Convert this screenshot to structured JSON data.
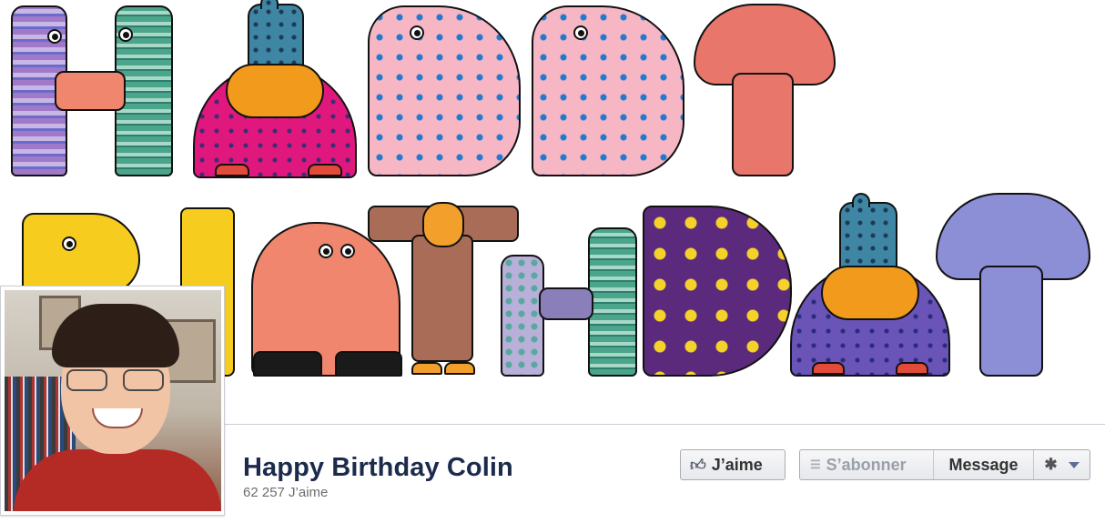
{
  "cover": {
    "image_description_icon": "happy-birthday-banner",
    "line1": "HAPPY",
    "line2": "BIRTHDAY"
  },
  "profile": {
    "picture_icon": "profile-photo"
  },
  "page": {
    "title": "Happy Birthday Colin",
    "likes": "62 257 J’aime"
  },
  "actions": {
    "like_label": "J’aime",
    "subscribe_label": "S’abonner",
    "message_label": "Message",
    "like_icon": "thumbs-up-icon",
    "subscribe_icon": "rss-icon",
    "settings_icon": "gear-icon",
    "dropdown_icon": "caret-down-icon"
  },
  "colors": {
    "title": "#1c2b4c",
    "muted": "#6d6d6d",
    "button_border": "#a8acb4",
    "disabled_text": "#9aa0aa"
  }
}
